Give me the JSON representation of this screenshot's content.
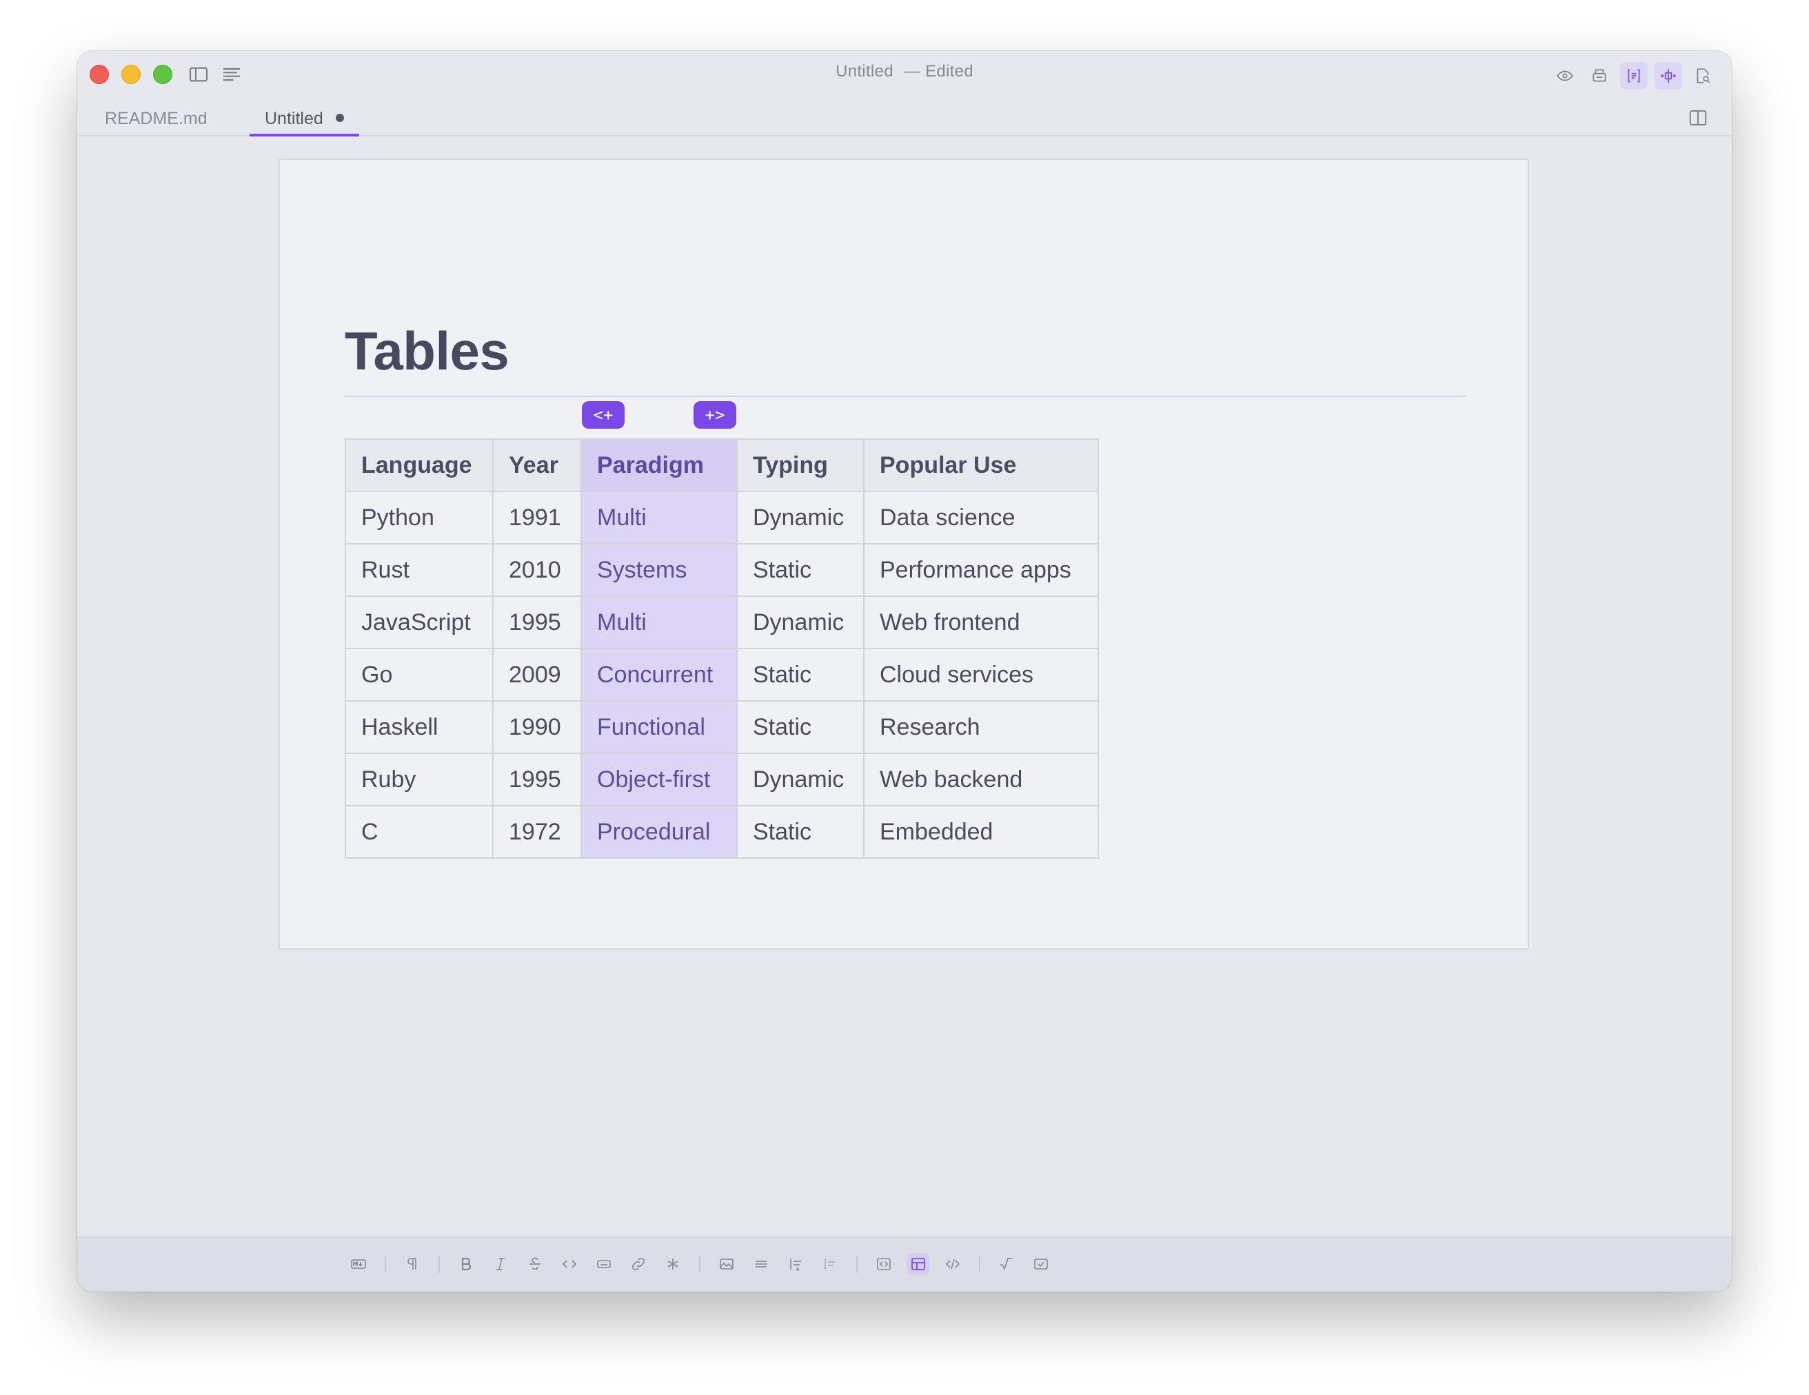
{
  "window": {
    "title": "Untitled",
    "title_status": "— Edited"
  },
  "tabs": [
    {
      "label": "README.md",
      "active": false
    },
    {
      "label": "Untitled",
      "active": true,
      "unsaved": true
    }
  ],
  "document": {
    "heading": "Tables",
    "column_buttons": {
      "insert_left": "<+",
      "insert_right": "+>"
    },
    "table": {
      "headers": [
        "Language",
        "Year",
        "Paradigm",
        "Typing",
        "Popular Use"
      ],
      "highlighted_column": 2,
      "rows": [
        [
          "Python",
          "1991",
          "Multi",
          "Dynamic",
          "Data science"
        ],
        [
          "Rust",
          "2010",
          "Systems",
          "Static",
          "Performance apps"
        ],
        [
          "JavaScript",
          "1995",
          "Multi",
          "Dynamic",
          "Web frontend"
        ],
        [
          "Go",
          "2009",
          "Concurrent",
          "Static",
          "Cloud services"
        ],
        [
          "Haskell",
          "1990",
          "Functional",
          "Static",
          "Research"
        ],
        [
          "Ruby",
          "1995",
          "Object-first",
          "Dynamic",
          "Web backend"
        ],
        [
          "C",
          "1972",
          "Procedural",
          "Static",
          "Embedded"
        ]
      ]
    }
  },
  "colors": {
    "accent": "#7a48e6",
    "highlight": "#ddd5f5",
    "close": "#ee5f57",
    "minimize": "#f5bd2f",
    "zoom": "#5fc43f"
  },
  "icons": {
    "titlebar_left": [
      "sidebar-icon",
      "outline-icon"
    ],
    "titlebar_right": [
      "eye-icon",
      "print-icon",
      "document-mode-icon",
      "split-mode-icon",
      "search-document-icon"
    ],
    "bottom_toolbar": [
      "markdown-icon",
      "paragraph-icon",
      "bold-icon",
      "italic-icon",
      "strikethrough-icon",
      "inline-code-icon",
      "keyboard-icon",
      "link-icon",
      "footnote-icon",
      "image-icon",
      "horizontal-rule-icon",
      "ordered-list-icon",
      "unordered-list-icon",
      "code-block-icon",
      "table-icon",
      "html-icon",
      "math-icon",
      "task-list-icon"
    ]
  }
}
